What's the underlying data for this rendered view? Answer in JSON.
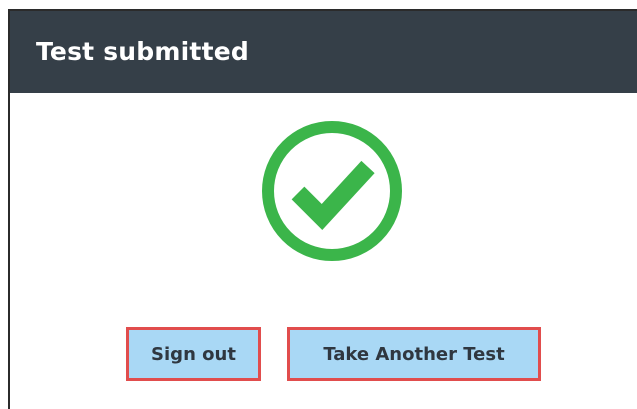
{
  "dialog": {
    "title": "Test submitted",
    "status_icon": "check-circle-icon",
    "colors": {
      "header_bg": "#353f48",
      "success_green": "#3bb54a",
      "button_bg": "#a9d8f5",
      "button_outline": "#e14d4d"
    }
  },
  "actions": {
    "sign_out_label": "Sign out",
    "take_another_label": "Take Another Test"
  }
}
